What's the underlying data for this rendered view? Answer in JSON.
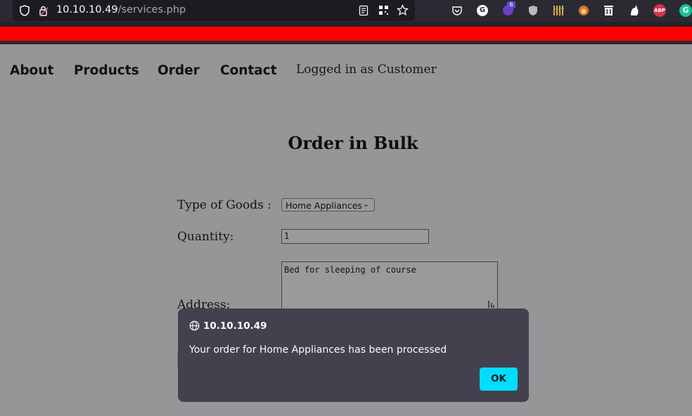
{
  "browser": {
    "url_host": "10.10.10.49",
    "url_path": "/services.php",
    "icons": [
      "shield-icon",
      "lock-icon",
      "reader-mode-icon",
      "qr-icon",
      "bookmark-star-icon",
      "pocket-icon",
      "google-extension-icon",
      "extension-badge-icon",
      "privacy-badger-icon",
      "equalizer-extension-icon",
      "fox-extension-icon",
      "trash-extension-icon",
      "cat-extension-icon",
      "adblock-plus-icon",
      "grammarly-icon"
    ],
    "extension_badge": "6",
    "google_letter": "G",
    "abp_label": "ABP",
    "grammarly_letter": "G"
  },
  "nav": {
    "about": "About",
    "products": "Products",
    "order": "Order",
    "contact": "Contact",
    "logged_in": "Logged in as Customer"
  },
  "page": {
    "title": "Order in Bulk"
  },
  "form": {
    "goods_label": "Type of Goods :",
    "goods_value": "Home Appliances",
    "quantity_label": "Quantity:",
    "quantity_value": "1",
    "address_label": "Address:",
    "address_value": "Bed for sleeping of course"
  },
  "dialog": {
    "origin": "10.10.10.49",
    "message": "Your order for Home Appliances has been processed",
    "ok_label": "OK"
  },
  "colors": {
    "accent_red": "#ff0000",
    "ok_button": "#00ddff",
    "dialog_bg": "#42414d"
  }
}
